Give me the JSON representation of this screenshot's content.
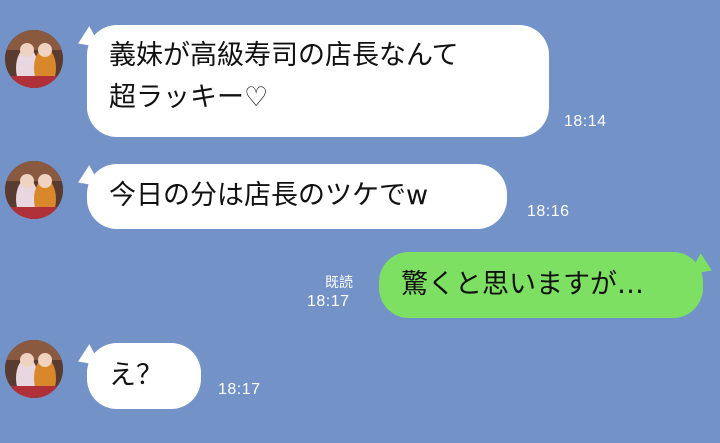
{
  "messages": [
    {
      "side": "in",
      "lines": [
        "義妹が高級寿司の店長なんて",
        "超ラッキー♡"
      ],
      "time": "18:14"
    },
    {
      "side": "in",
      "lines": [
        "今日の分は店長のツケでw"
      ],
      "time": "18:16"
    },
    {
      "side": "out",
      "lines": [
        "驚くと思いますが…"
      ],
      "time": "18:17",
      "read_label": "既読"
    },
    {
      "side": "in",
      "lines": [
        "え？"
      ],
      "time": "18:17"
    }
  ],
  "colors": {
    "background": "#7292c8",
    "incoming_bubble": "#ffffff",
    "outgoing_bubble": "#7ee062"
  }
}
